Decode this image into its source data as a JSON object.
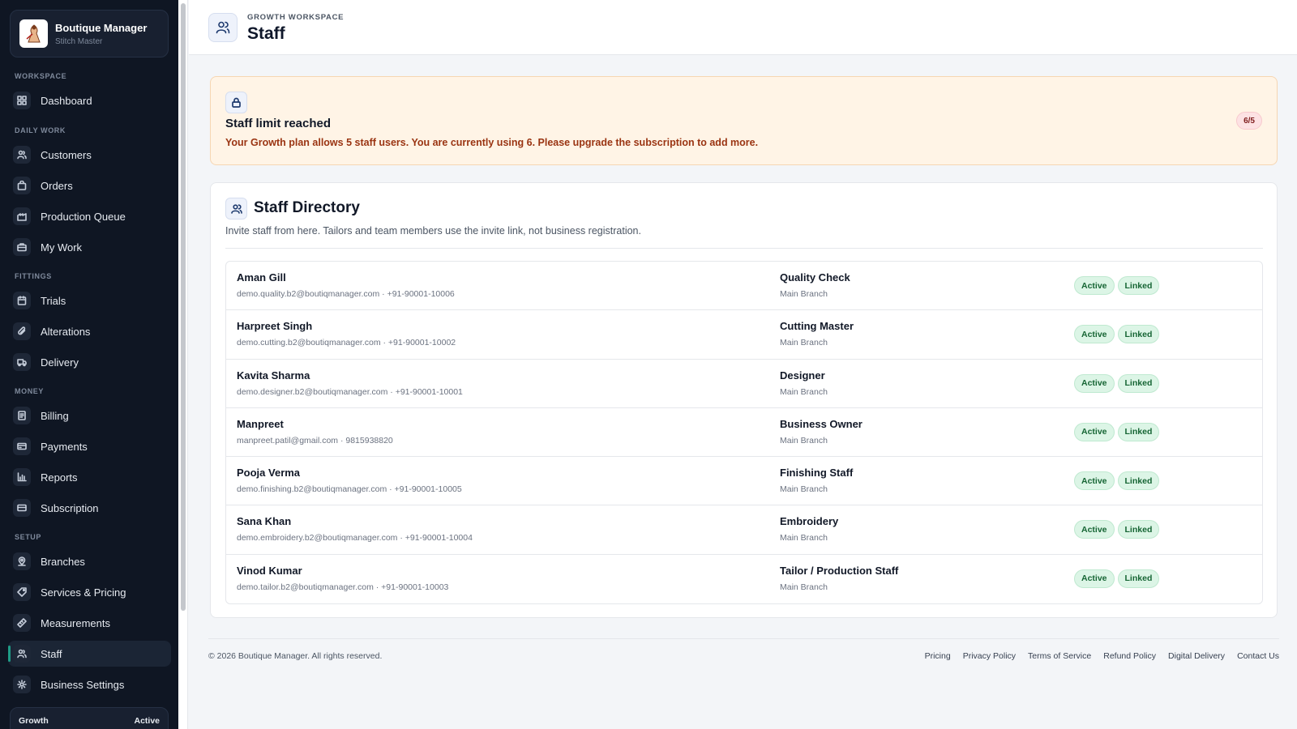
{
  "brand": {
    "name": "Boutique Manager",
    "subtitle": "Stitch Master"
  },
  "sidebar": {
    "sections": {
      "workspace": "Workspace",
      "daily_work": "Daily Work",
      "fittings": "Fittings",
      "money": "Money",
      "setup": "Setup"
    },
    "items": {
      "dashboard": "Dashboard",
      "customers": "Customers",
      "orders": "Orders",
      "production_queue": "Production Queue",
      "my_work": "My Work",
      "trials": "Trials",
      "alterations": "Alterations",
      "delivery": "Delivery",
      "billing": "Billing",
      "payments": "Payments",
      "reports": "Reports",
      "subscription": "Subscription",
      "branches": "Branches",
      "services_pricing": "Services & Pricing",
      "measurements": "Measurements",
      "staff": "Staff",
      "business_settings": "Business Settings"
    },
    "plan": {
      "name": "Growth",
      "status": "Active"
    }
  },
  "header": {
    "kicker": "GROWTH WORKSPACE",
    "title": "Staff"
  },
  "alert": {
    "title": "Staff limit reached",
    "message": "Your Growth plan allows 5 staff users. You are currently using 6. Please upgrade the subscription to add more.",
    "count": "6/5"
  },
  "directory": {
    "title": "Staff Directory",
    "description": "Invite staff from here. Tailors and team members use the invite link, not business registration.",
    "staff": [
      {
        "name": "Aman Gill",
        "contact": "demo.quality.b2@boutiqmanager.com · +91-90001-10006",
        "role": "Quality Check",
        "branch": "Main Branch",
        "status": "Active",
        "link": "Linked"
      },
      {
        "name": "Harpreet Singh",
        "contact": "demo.cutting.b2@boutiqmanager.com · +91-90001-10002",
        "role": "Cutting Master",
        "branch": "Main Branch",
        "status": "Active",
        "link": "Linked"
      },
      {
        "name": "Kavita Sharma",
        "contact": "demo.designer.b2@boutiqmanager.com · +91-90001-10001",
        "role": "Designer",
        "branch": "Main Branch",
        "status": "Active",
        "link": "Linked"
      },
      {
        "name": "Manpreet",
        "contact": "manpreet.patil@gmail.com · 9815938820",
        "role": "Business Owner",
        "branch": "Main Branch",
        "status": "Active",
        "link": "Linked"
      },
      {
        "name": "Pooja Verma",
        "contact": "demo.finishing.b2@boutiqmanager.com · +91-90001-10005",
        "role": "Finishing Staff",
        "branch": "Main Branch",
        "status": "Active",
        "link": "Linked"
      },
      {
        "name": "Sana Khan",
        "contact": "demo.embroidery.b2@boutiqmanager.com · +91-90001-10004",
        "role": "Embroidery",
        "branch": "Main Branch",
        "status": "Active",
        "link": "Linked"
      },
      {
        "name": "Vinod Kumar",
        "contact": "demo.tailor.b2@boutiqmanager.com · +91-90001-10003",
        "role": "Tailor / Production Staff",
        "branch": "Main Branch",
        "status": "Active",
        "link": "Linked"
      }
    ]
  },
  "footer": {
    "copyright": "© 2026 Boutique Manager. All rights reserved.",
    "links": [
      "Pricing",
      "Privacy Policy",
      "Terms of Service",
      "Refund Policy",
      "Digital Delivery",
      "Contact Us"
    ]
  },
  "colors": {
    "sidebar_bg": "#0f1623",
    "accent": "#1f9d87",
    "alert_bg": "#fff4e6",
    "badge_green": "#dcf5e6"
  }
}
